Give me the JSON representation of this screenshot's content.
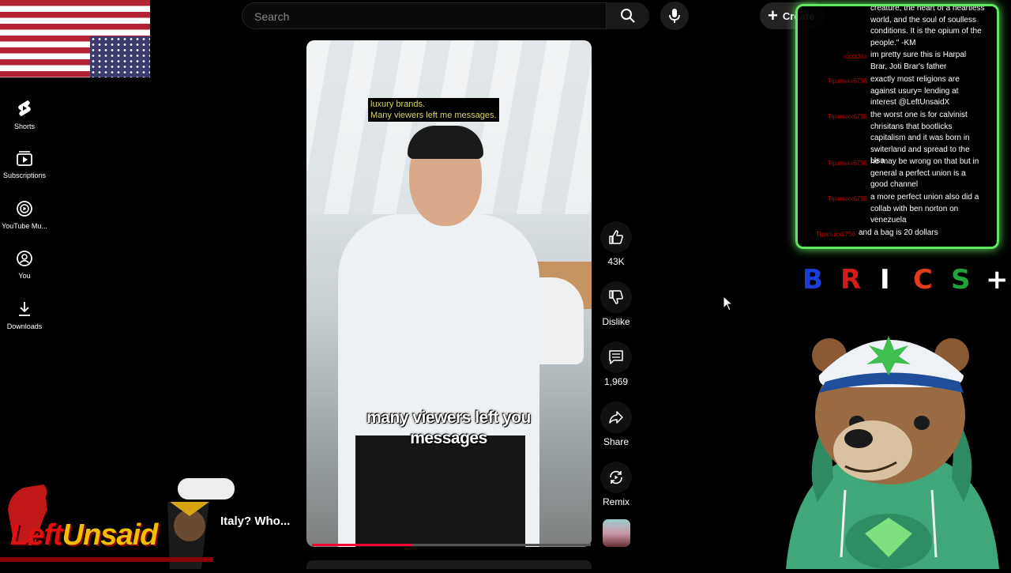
{
  "sidebar": {
    "items": [
      {
        "label": "Shorts",
        "icon": "shorts-icon"
      },
      {
        "label": "Subscriptions",
        "icon": "subscriptions-icon"
      },
      {
        "label": "YouTube Mu...",
        "icon": "youtube-music-icon"
      },
      {
        "label": "You",
        "icon": "user-icon"
      },
      {
        "label": "Downloads",
        "icon": "download-icon"
      }
    ]
  },
  "header": {
    "search_placeholder": "Search",
    "create_label": "Create"
  },
  "video": {
    "caption_top": [
      "luxury brands.",
      "Many viewers left me messages."
    ],
    "caption_main": "many viewers left you messages",
    "progress_fraction": 0.36
  },
  "actions": {
    "likes": "43K",
    "dislike_label": "Dislike",
    "comments": "1,969",
    "share_label": "Share",
    "remix_label": "Remix"
  },
  "chat": {
    "messages": [
      {
        "user": "",
        "text": "creature, the heart of a heartless world, and the soul of soulless conditions. It is the opium of the people.\" -KM"
      },
      {
        "user": "cxxx3xx",
        "text": "im pretty sure this is Harpal Brar, Joti Brar's father"
      },
      {
        "user": "Tipanuxx6756",
        "text": "exactly most religions are against usury= lending at interest @LeftUnsaidX"
      },
      {
        "user": "Tipanuxx6756",
        "text": "the worst one is for calvinist chrisitans that bootlicks capitalism and it was born in switerland and spread to the Usa"
      },
      {
        "user": "Tipanuxx6756",
        "text": "he may be wrong on that but in general a perfect union is a good channel"
      },
      {
        "user": "Tipanuxx6756",
        "text": "a more perfect union also did a collab with ben norton on venezuela"
      },
      {
        "user": "Tipanuxx6756",
        "text": "and a bag is 20 dollars"
      }
    ]
  },
  "brics": {
    "letters": [
      {
        "char": "B",
        "color": "#1a3fd6"
      },
      {
        "char": "R",
        "color": "#d21c1c"
      },
      {
        "char": "I",
        "color": "#ffffff"
      },
      {
        "char": "C",
        "color": "#e23b1c"
      },
      {
        "char": "S",
        "color": "#22a23a"
      },
      {
        "char": "+",
        "color": "#ffffff"
      }
    ]
  },
  "overlay": {
    "logo_left": "Left",
    "logo_right": "Unsaid",
    "title": "Italy? Who..."
  },
  "colors": {
    "accent": "#ff0033",
    "chat_border": "#5fe85f"
  }
}
